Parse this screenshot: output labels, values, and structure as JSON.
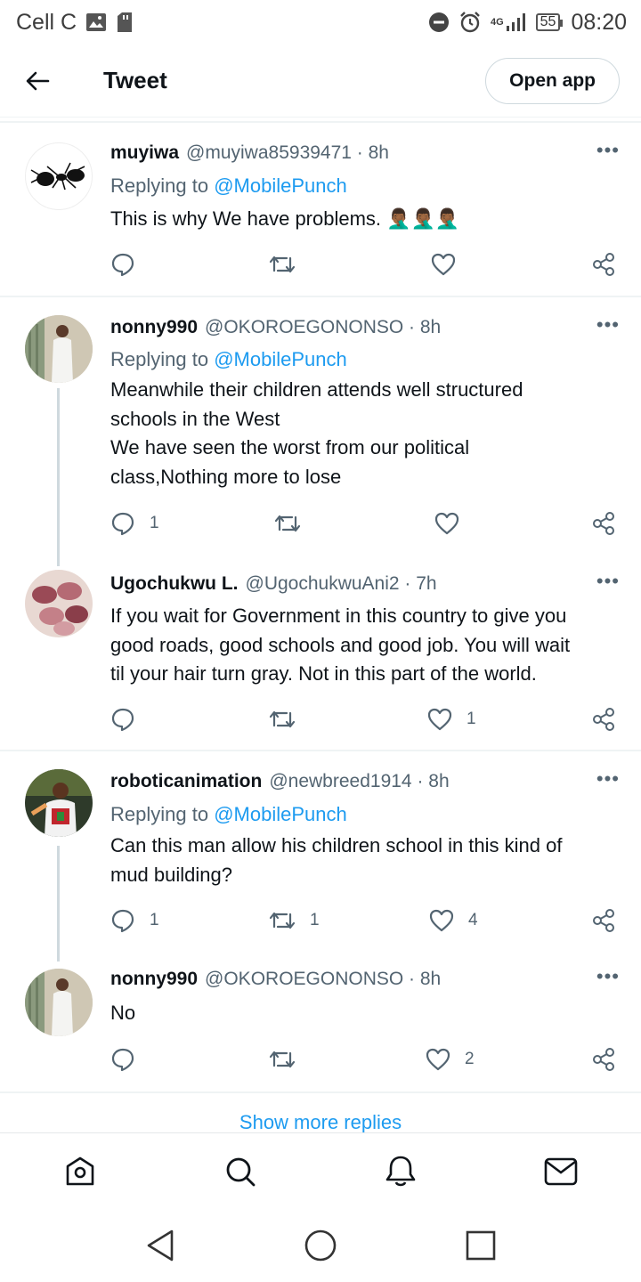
{
  "status": {
    "carrier": "Cell C",
    "network": "4G",
    "battery": "55",
    "time": "08:20"
  },
  "header": {
    "title": "Tweet",
    "open_app": "Open app"
  },
  "replying_label": "Replying to",
  "tweets": [
    {
      "name": "muyiwa",
      "handle": "@muyiwa85939471 · 8h",
      "replying_to": "@MobilePunch",
      "text": "This is why We have problems. 🤦🏾‍♂️🤦🏾‍♂️🤦🏾‍♂️",
      "reply_count": "",
      "retweet_count": "",
      "like_count": ""
    },
    {
      "name": "nonny990",
      "handle": "@OKOROEGONONSO · 8h",
      "replying_to": "@MobilePunch",
      "text_lines": [
        "Meanwhile their children attends well structured",
        "schools in the West",
        "We have seen the worst from our political",
        "class,Nothing more to lose"
      ],
      "reply_count": "1",
      "retweet_count": "",
      "like_count": ""
    },
    {
      "name": "Ugochukwu L.",
      "handle": "@UgochukwuAni2 · 7h",
      "text_lines": [
        "If you wait for Government in this country to give you",
        "good roads, good schools and good job. You will wait",
        "til your hair turn gray. Not in this part of the world."
      ],
      "reply_count": "",
      "retweet_count": "",
      "like_count": "1"
    },
    {
      "name": "roboticanimation",
      "handle": "@newbreed1914 · 8h",
      "replying_to": "@MobilePunch",
      "text_lines": [
        "Can this man allow his children school in this kind of",
        "mud building?"
      ],
      "reply_count": "1",
      "retweet_count": "1",
      "like_count": "4"
    },
    {
      "name": "nonny990",
      "handle": "@OKOROEGONONSO · 8h",
      "text": "No",
      "reply_count": "",
      "retweet_count": "",
      "like_count": "2"
    }
  ],
  "show_more": "Show more replies",
  "colors": {
    "accent": "#1d9bf0",
    "text": "#0f1419",
    "secondary": "#536471",
    "divider": "#eff3f4"
  }
}
